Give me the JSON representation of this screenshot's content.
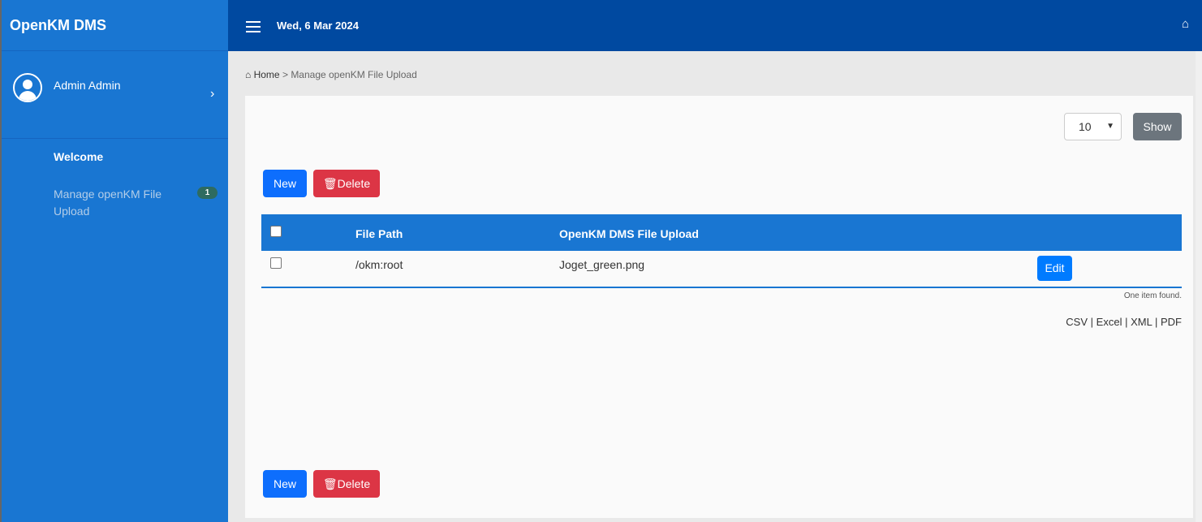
{
  "app": {
    "title": "OpenKM DMS",
    "date": "Wed, 6 Mar 2024"
  },
  "user": {
    "name": "Admin Admin"
  },
  "sidebar": {
    "items": [
      {
        "label": "Welcome"
      },
      {
        "label": "Manage openKM File Upload",
        "badge": "1"
      }
    ]
  },
  "breadcrumb": {
    "home": "Home",
    "separator": ">",
    "current": "Manage openKM File Upload"
  },
  "toolbar": {
    "page_size": "10",
    "show_label": "Show",
    "new_label": "New",
    "delete_label": "Delete"
  },
  "table": {
    "columns": [
      "File Path",
      "OpenKM DMS File Upload"
    ],
    "rows": [
      {
        "file_path": "/okm:root",
        "file": "Joget_green.png",
        "action": "Edit"
      }
    ],
    "summary": "One item found."
  },
  "export": {
    "csv": "CSV",
    "excel": "Excel",
    "xml": "XML",
    "pdf": "PDF",
    "sep": "|"
  }
}
